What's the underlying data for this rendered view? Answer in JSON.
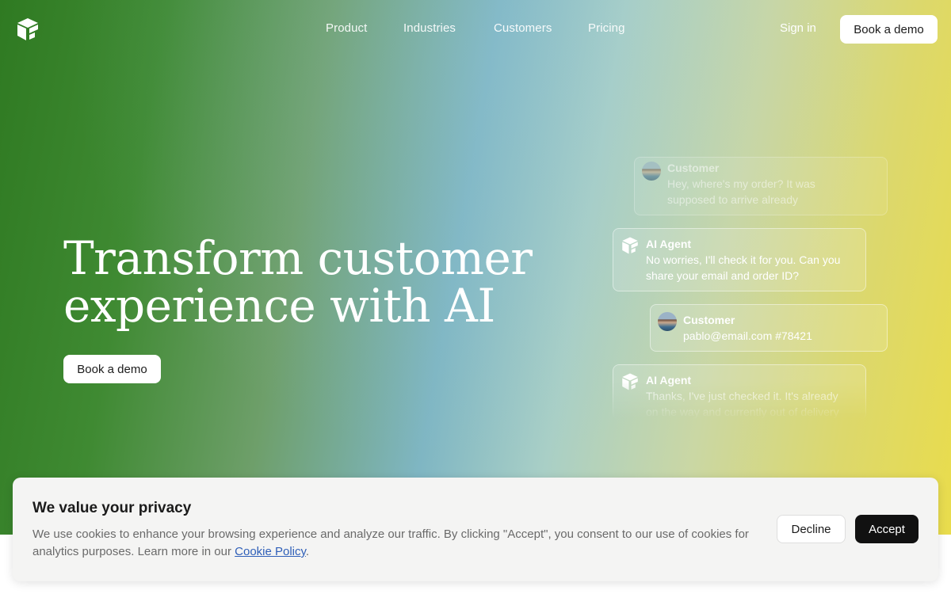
{
  "nav": {
    "links": [
      "Product",
      "Industries",
      "Customers",
      "Pricing"
    ],
    "sign_in": "Sign in",
    "book_demo": "Book a demo"
  },
  "hero": {
    "headline_line1": "Transform customer",
    "headline_line2": "experience with AI",
    "cta": "Book a demo"
  },
  "chat": [
    {
      "sender": "Customer",
      "message_line1": "Hey, where's my order? It was",
      "message_line2": "supposed to arrive already"
    },
    {
      "sender": "AI Agent",
      "message_line1": "No worries, I'll check it for you. Can you",
      "message_line2": "share your email and order ID?"
    },
    {
      "sender": "Customer",
      "message_line1": "pablo@email.com #78421",
      "message_line2": ""
    },
    {
      "sender": "AI Agent",
      "message_line1": "Thanks, I've just checked it. It's already",
      "message_line2": "on the way and currently out of delivery"
    }
  ],
  "cookie": {
    "title": "We value your privacy",
    "text": "We use cookies to enhance your browsing experience and analyze our traffic. By clicking \"Accept\", you consent to our use of cookies for analytics purposes. Learn more in our ",
    "link": "Cookie Policy",
    "text_end": ".",
    "decline": "Decline",
    "accept": "Accept"
  },
  "colors": {
    "hero_left": "#2f7a22",
    "hero_mid": "#7fb6c3",
    "hero_right": "#e9dc4c",
    "accept_button": "#111111",
    "link": "#2f5fb8"
  }
}
